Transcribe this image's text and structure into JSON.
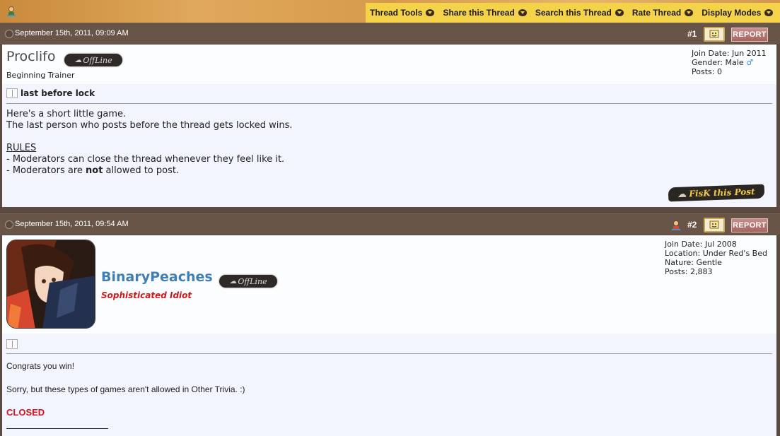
{
  "toolbar": {
    "items": [
      "Thread Tools",
      "Share this Thread",
      "Search this Thread",
      "Rate Thread",
      "Display Modes"
    ]
  },
  "posts": [
    {
      "date": "September 15th, 2011, 09:09 AM",
      "number": "#1",
      "report_label": "REPORT",
      "username": "Proclifo",
      "status": "OffLine",
      "rank": "Beginning Trainer",
      "info": {
        "join": "Join Date: Jun 2011",
        "gender": "Gender: Male",
        "posts": "Posts: 0"
      },
      "title": "last before lock",
      "body": {
        "l1": "Here's a short little game.",
        "l2": "The last person who posts before the thread gets locked wins.",
        "rules": "RULES",
        "r1": "- Moderators can close the thread whenever they feel like it.",
        "r2a": "- Moderators are ",
        "r2b": "not",
        "r2c": " allowed to post."
      },
      "risk_label": "FisK this Post"
    },
    {
      "date": "September 15th, 2011, 09:54 AM",
      "number": "#2",
      "report_label": "REPORT",
      "username": "BinaryPeaches",
      "status": "OffLine",
      "rank": "Sophisticated Idiot",
      "info": {
        "join": "Join Date: Jul 2008",
        "location": "Location: Under Red's Bed",
        "nature": "Nature: Gentle",
        "posts": "Posts: 2,883"
      },
      "body": {
        "l1": "Congrats you win!",
        "l2": "Sorry, but these types of games aren't allowed in Other Trivia. :)",
        "closed": "CLOSED"
      }
    }
  ],
  "colors": {
    "header_bar": "#695548",
    "toolbar": "#f4d24a",
    "username_blue": "#3f7fb5",
    "rank_red": "#cc1a1a",
    "closed_red": "#d4121f"
  }
}
